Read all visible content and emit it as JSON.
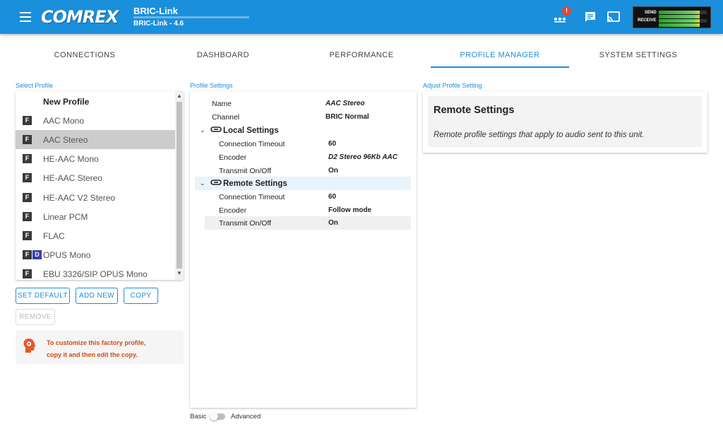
{
  "header": {
    "logo": "COMREX",
    "app_title": "BRIC-Link",
    "app_version": "BRIC-Link - 4.6",
    "notification_badge": "!",
    "meter": {
      "send_label": "SEND",
      "receive_label": "RECEIVE"
    },
    "icons": [
      "menu-icon",
      "network-icon",
      "chat-icon",
      "cast-icon"
    ]
  },
  "tabs": [
    {
      "label": "CONNECTIONS"
    },
    {
      "label": "DASHBOARD"
    },
    {
      "label": "PERFORMANCE"
    },
    {
      "label": "PROFILE MANAGER"
    },
    {
      "label": "SYSTEM SETTINGS"
    }
  ],
  "select_profile": {
    "label": "Select Profile",
    "items": [
      {
        "label": "New Profile",
        "tags": []
      },
      {
        "label": "AAC Mono",
        "tags": [
          "F"
        ]
      },
      {
        "label": "AAC Stereo",
        "tags": [
          "F"
        ]
      },
      {
        "label": "HE-AAC Mono",
        "tags": [
          "F"
        ]
      },
      {
        "label": "HE-AAC Stereo",
        "tags": [
          "F"
        ]
      },
      {
        "label": "HE-AAC V2 Stereo",
        "tags": [
          "F"
        ]
      },
      {
        "label": "Linear PCM",
        "tags": [
          "F"
        ]
      },
      {
        "label": "FLAC",
        "tags": [
          "F"
        ]
      },
      {
        "label": "OPUS Mono",
        "tags": [
          "F",
          "D"
        ]
      },
      {
        "label": "EBU 3326/SIP OPUS Mono",
        "tags": [
          "F"
        ]
      }
    ],
    "selected_index": 2
  },
  "buttons": {
    "set_default": "SET DEFAULT",
    "add_new": "ADD NEW",
    "copy": "COPY",
    "remove": "REMOVE"
  },
  "notice": {
    "line1": "To customize this factory profile,",
    "line2": "copy it and then edit the copy."
  },
  "profile_settings": {
    "label": "Profile Settings",
    "name_label": "Name",
    "name_value": "AAC Stereo",
    "channel_label": "Channel",
    "channel_value": "BRIC Normal",
    "local": {
      "title": "Local Settings",
      "rows": [
        {
          "key": "Connection Timeout",
          "value": "60"
        },
        {
          "key": "Encoder",
          "value": "D2 Stereo 96Kb AAC"
        },
        {
          "key": "Transmit On/Off",
          "value": "On"
        }
      ]
    },
    "remote": {
      "title": "Remote Settings",
      "rows": [
        {
          "key": "Connection Timeout",
          "value": "60"
        },
        {
          "key": "Encoder",
          "value": "Follow mode"
        },
        {
          "key": "Transmit On/Off",
          "value": "On"
        }
      ]
    }
  },
  "mode_toggle": {
    "basic": "Basic",
    "advanced": "Advanced"
  },
  "adjust": {
    "label": "Adjust Profile Setting",
    "title": "Remote Settings",
    "description": "Remote profile settings that apply to audio sent to this unit."
  }
}
